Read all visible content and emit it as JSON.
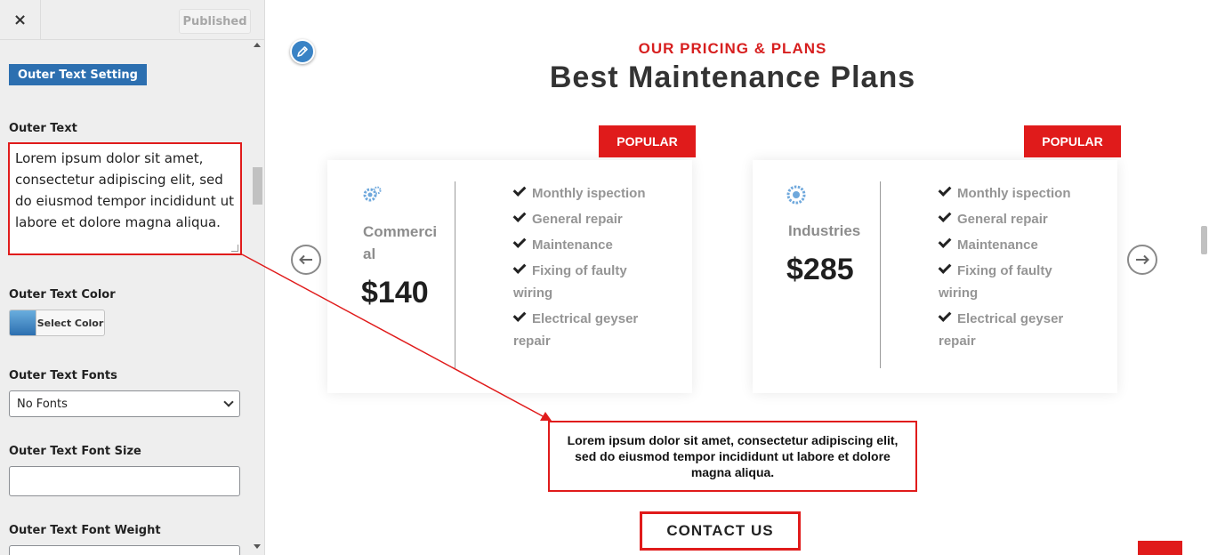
{
  "panel": {
    "close_label": "×",
    "publish_label": "Published",
    "section_title": "Outer Text Setting",
    "outer_text": {
      "label": "Outer Text",
      "value": "Lorem ipsum dolor sit amet, consectetur adipiscing elit, sed do eiusmod tempor incididunt ut labore et dolore magna aliqua."
    },
    "outer_text_color": {
      "label": "Outer Text Color",
      "button_label": "Select Color",
      "swatch_color": "#2c6fb0"
    },
    "outer_text_fonts": {
      "label": "Outer Text Fonts",
      "selected": "No Fonts"
    },
    "outer_text_font_size": {
      "label": "Outer Text Font Size",
      "value": ""
    },
    "outer_text_font_weight": {
      "label": "Outer Text Font Weight"
    }
  },
  "preview": {
    "subtitle": "OUR PRICING & PLANS",
    "title": "Best Maintenance Plans",
    "plans": [
      {
        "tag": "POPULAR",
        "name_line1": "Commerci",
        "name_line2": "al",
        "price": "$140",
        "features": [
          "Monthly ispection",
          "General repair",
          "Maintenance",
          "Fixing of faulty wiring",
          "Electrical geyser repair"
        ]
      },
      {
        "tag": "POPULAR",
        "name_line1": "Industries",
        "name_line2": "",
        "price": "$285",
        "features": [
          "Monthly ispection",
          "General repair",
          "Maintenance",
          "Fixing of faulty wiring",
          "Electrical geyser repair"
        ]
      }
    ],
    "outer_text": "Lorem ipsum dolor sit amet, consectetur adipiscing elit, sed do eiusmod tempor incididunt ut labore et dolore magna aliqua.",
    "contact_label": "CONTACT US"
  },
  "colors": {
    "accent_red": "#e01b1b",
    "subtitle_red": "#d71f1f",
    "badge_blue": "#2c6fb0"
  },
  "icons": [
    "close-icon",
    "pencil-icon",
    "gear-icon",
    "arrow-left-icon",
    "arrow-right-icon",
    "check-icon",
    "chevron-down-icon"
  ]
}
